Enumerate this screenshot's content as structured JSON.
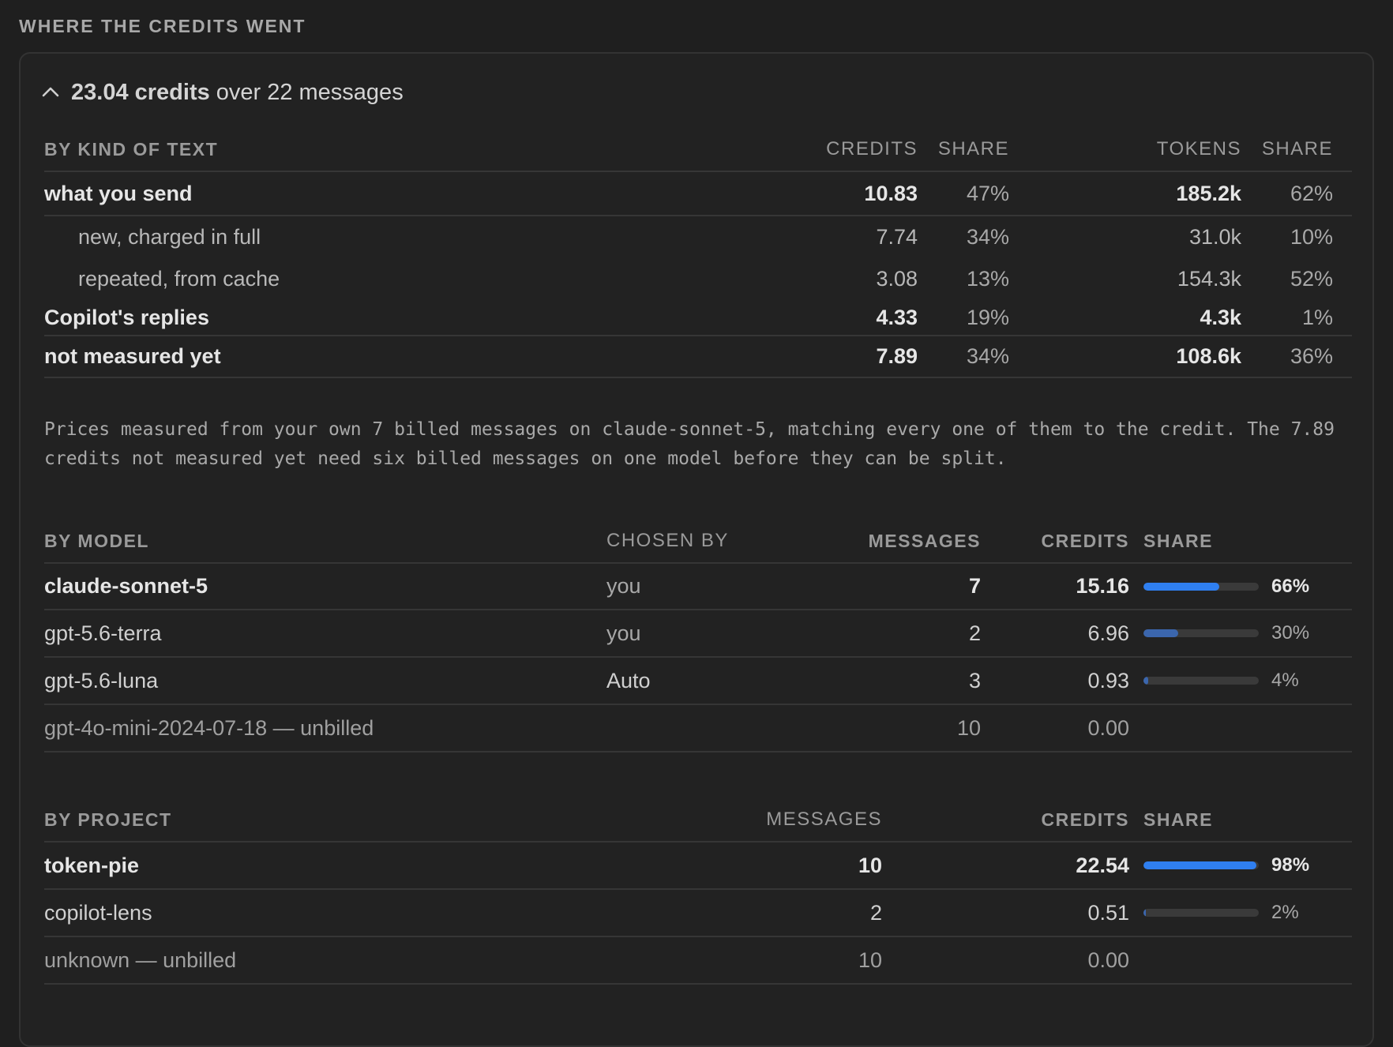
{
  "section_title": "WHERE THE CREDITS WENT",
  "summary": {
    "total_label": "23.04 credits",
    "rest_label": "over 22 messages"
  },
  "kind_table": {
    "headers": {
      "label": "BY KIND OF TEXT",
      "credits": "CREDITS",
      "credit_share": "SHARE",
      "tokens": "TOKENS",
      "token_share": "SHARE"
    },
    "rows": [
      {
        "label": "what you send",
        "credits": "10.83",
        "credit_share": "47%",
        "tokens": "185.2k",
        "token_share": "62%",
        "level": "top"
      },
      {
        "label": "new, charged in full",
        "credits": "7.74",
        "credit_share": "34%",
        "tokens": "31.0k",
        "token_share": "10%",
        "level": "sub"
      },
      {
        "label": "repeated, from cache",
        "credits": "3.08",
        "credit_share": "13%",
        "tokens": "154.3k",
        "token_share": "52%",
        "level": "sub"
      },
      {
        "label": "Copilot's replies",
        "credits": "4.33",
        "credit_share": "19%",
        "tokens": "4.3k",
        "token_share": "1%",
        "level": "top"
      },
      {
        "label": "not measured yet",
        "credits": "7.89",
        "credit_share": "34%",
        "tokens": "108.6k",
        "token_share": "36%",
        "level": "top"
      }
    ]
  },
  "note": "Prices measured from your own 7 billed messages on claude-sonnet-5, matching every one of them to the credit. The 7.89 credits not measured yet need six billed messages on one model before they can be split.",
  "model_table": {
    "headers": {
      "label": "BY MODEL",
      "chosen_by": "CHOSEN BY",
      "messages": "MESSAGES",
      "credits": "CREDITS",
      "share": "SHARE"
    },
    "rows": [
      {
        "label": "claude-sonnet-5",
        "chosen_by": "you",
        "messages": "7",
        "credits": "15.16",
        "share": "66%",
        "share_fraction": 0.66
      },
      {
        "label": "gpt-5.6-terra",
        "chosen_by": "you",
        "messages": "2",
        "credits": "6.96",
        "share": "30%",
        "share_fraction": 0.3
      },
      {
        "label": "gpt-5.6-luna",
        "chosen_by": "Auto",
        "messages": "3",
        "credits": "0.93",
        "share": "4%",
        "share_fraction": 0.04
      },
      {
        "label": "gpt-4o-mini-2024-07-18 — unbilled",
        "chosen_by": "",
        "messages": "10",
        "credits": "0.00",
        "share": "",
        "share_fraction": null
      }
    ]
  },
  "project_table": {
    "headers": {
      "label": "BY PROJECT",
      "messages": "MESSAGES",
      "credits": "CREDITS",
      "share": "SHARE"
    },
    "rows": [
      {
        "label": "token-pie",
        "messages": "10",
        "credits": "22.54",
        "share": "98%",
        "share_fraction": 0.98
      },
      {
        "label": "copilot-lens",
        "messages": "2",
        "credits": "0.51",
        "share": "2%",
        "share_fraction": 0.02
      },
      {
        "label": "unknown — unbilled",
        "messages": "10",
        "credits": "0.00",
        "share": "",
        "share_fraction": null
      }
    ]
  },
  "colors": {
    "bar_primary": "#2f7ff0",
    "bar_secondary": "#3b66ad",
    "bar_track": "#3a3a3a"
  }
}
